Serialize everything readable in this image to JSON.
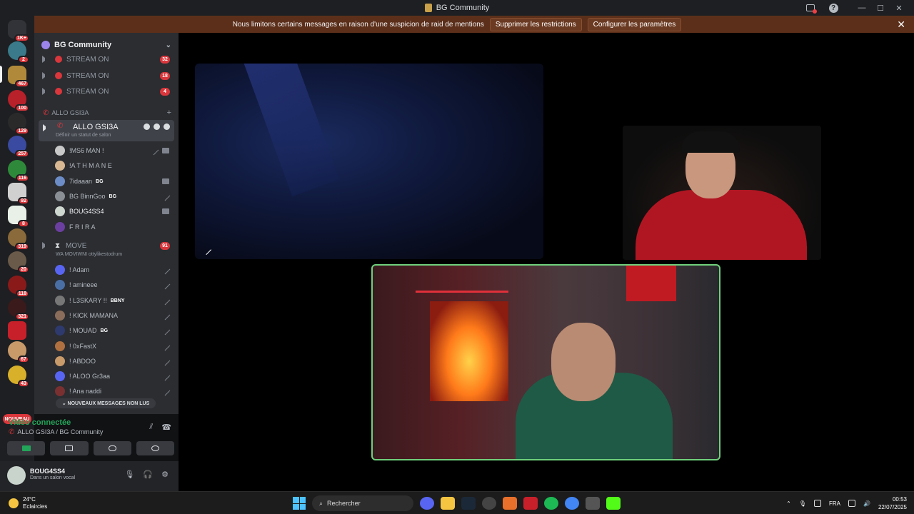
{
  "window": {
    "title": "BG Community"
  },
  "notice": {
    "text": "Nous limitons certains messages en raison d'une suspicion de raid de mentions",
    "remove_label": "Supprimer les restrictions",
    "configure_label": "Configurer les paramètres",
    "close": "✕"
  },
  "guilds": {
    "badges": [
      "1K+",
      "2",
      "467",
      "100",
      "129",
      "257",
      "116",
      "92",
      "8",
      "319",
      "20",
      "118",
      "321",
      "67",
      "43"
    ],
    "nouveau": "NOUVEAU"
  },
  "server": {
    "name": "BG Community",
    "chevron": "⌄"
  },
  "channels": {
    "streams": [
      {
        "name": "STREAM ON",
        "badge": "32"
      },
      {
        "name": "STREAM ON",
        "badge": "18"
      },
      {
        "name": "STREAM ON",
        "badge": "4"
      }
    ],
    "category": "ALLO GSI3A",
    "active": {
      "name": "ALLO GSI3A",
      "status": "Définir un statut de salon"
    },
    "voice_users_1": [
      {
        "name": "!MS6 MAN !",
        "tag": "",
        "color": "#c9c9c9"
      },
      {
        "name": "!A T H M A N E",
        "tag": "",
        "color": "#d8b892"
      },
      {
        "name": "7idaaan",
        "tag": "BG",
        "color": "#6c8cc7"
      },
      {
        "name": "BG BinnGoo",
        "tag": "BG",
        "color": "#8a8f95"
      },
      {
        "name": "BOUG4SS4",
        "tag": "",
        "color": "#cfd8d0"
      },
      {
        "name": "F R I R A",
        "tag": "",
        "color": "#6b3fa0"
      }
    ],
    "move": {
      "name": "MOVE",
      "badge": "91",
      "status": "WA MOVIWNI ottylikestodrum"
    },
    "voice_users_2": [
      {
        "name": "! Adam",
        "tag": "",
        "color": "#5865f2"
      },
      {
        "name": "! amineee",
        "tag": "",
        "color": "#4a6fa5"
      },
      {
        "name": "! L3SKARY !!",
        "tag": "BBNY",
        "color": "#777"
      },
      {
        "name": "! KICK MAMANA",
        "tag": "",
        "color": "#8a6d5a"
      },
      {
        "name": "! MOUAD",
        "tag": "BG",
        "color": "#2e3a6e"
      },
      {
        "name": "! 0xFastX",
        "tag": "",
        "color": "#b07040"
      },
      {
        "name": "! ABDOO",
        "tag": "",
        "color": "#c99a6a"
      },
      {
        "name": "! ALOO Gr3aa",
        "tag": "",
        "color": "#5865f2"
      },
      {
        "name": "! Ana naddi",
        "tag": "",
        "color": "#7a3030"
      }
    ],
    "new_messages": "⌄ NOUVEAUX MESSAGES NON LUS"
  },
  "voice": {
    "status": "Vidéo connectée",
    "location": "ALLO GSI3A / BG Community"
  },
  "user": {
    "name": "BOUG4SS4",
    "status": "Dans un salon vocal"
  },
  "taskbar": {
    "temperature": "24°C",
    "weather": "Eclaircies",
    "search": "Rechercher",
    "lang": "FRA",
    "time": "00:53",
    "date": "22/07/2025"
  },
  "colors": {
    "accent_green": "#23a559",
    "badge_red": "#da373c",
    "notice_bg": "#5c2f1a"
  }
}
